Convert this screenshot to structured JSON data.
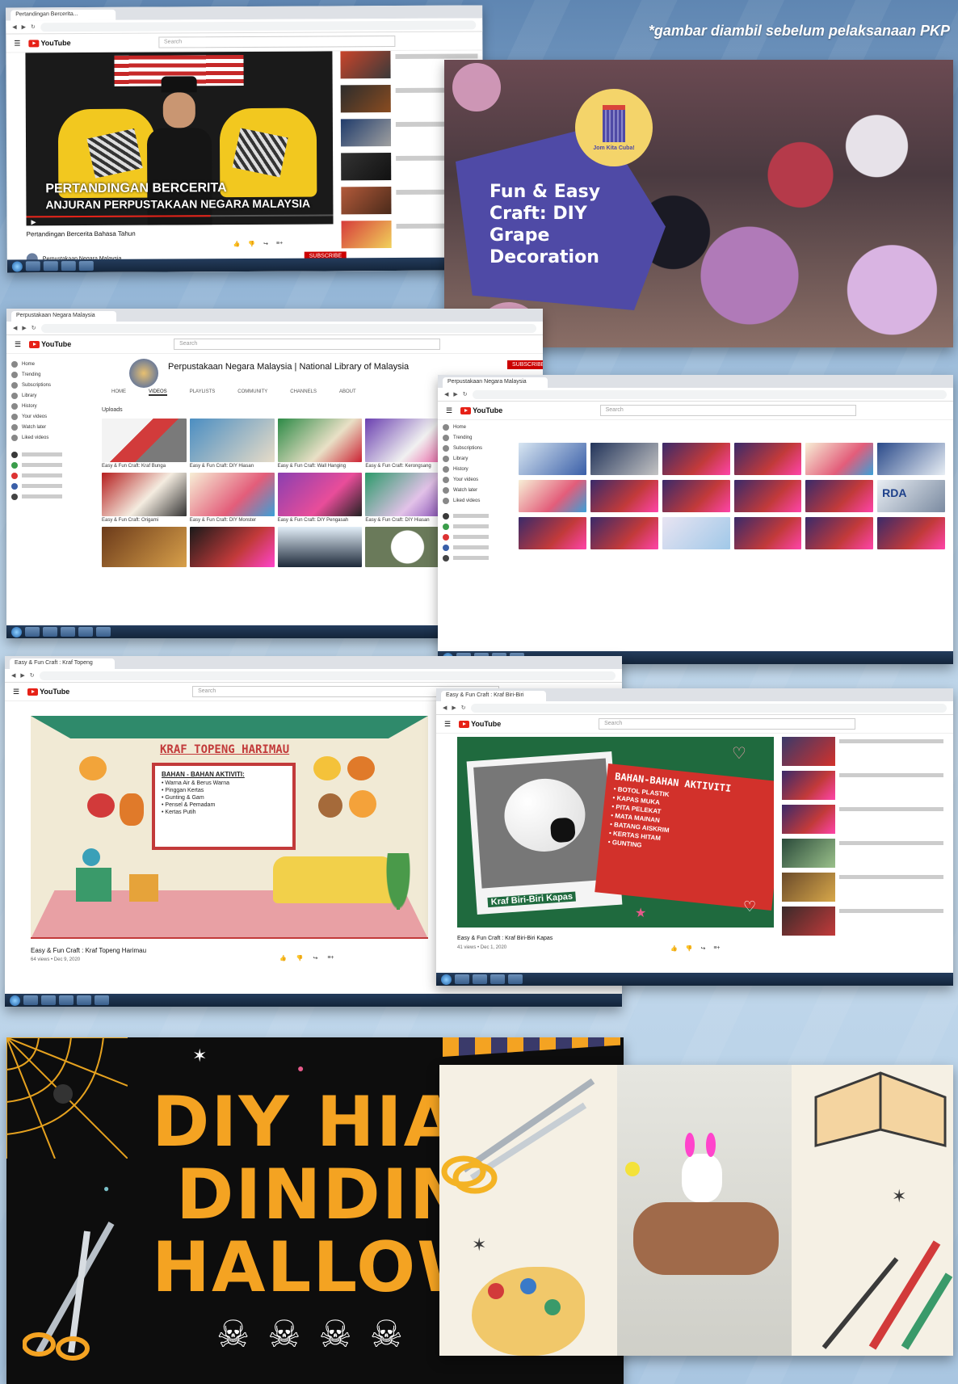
{
  "caption": "*gambar diambil sebelum pelaksanaan PKP",
  "shot1": {
    "tab": "Pertandingan Bercerita...",
    "video_overlay_line1": "PERTANDINGAN BERCERITA",
    "video_overlay_line2": "ANJURAN PERPUSTAKAAN NEGARA MALAYSIA",
    "video_title": "Pertandingan Bercerita Bahasa Tahun",
    "channel": "Perpustakaan Negara Malaysia",
    "subscribe": "SUBSCRIBE"
  },
  "shot2": {
    "title_line1": "Fun & Easy",
    "title_line2": "Craft: DIY",
    "title_line3": "Grape",
    "title_line4": "Decoration",
    "badge": "Jom Kita Cuba!"
  },
  "shot3": {
    "tab": "Perpustakaan Negara Malaysia",
    "channel_name": "Perpustakaan Negara Malaysia | National Library of Malaysia",
    "subscribe": "SUBSCRIBE",
    "tabs": [
      "HOME",
      "VIDEOS",
      "PLAYLISTS",
      "COMMUNITY",
      "CHANNELS",
      "ABOUT"
    ],
    "sidebar": [
      "Home",
      "Trending",
      "Subscriptions",
      "Library",
      "History",
      "Your videos",
      "Watch later",
      "Liked videos"
    ],
    "uploads_label": "Uploads",
    "video_titles": [
      "Easy & Fun Craft: Kraf Bunga",
      "Easy & Fun Craft: DIY Hiasan",
      "Easy & Fun Craft: Wall Hanging",
      "Easy & Fun Craft: Kerongsang",
      "Easy & Fun Craft: Origami",
      "Easy & Fun Craft: DIY Monster",
      "Easy & Fun Craft: DIY Pengasah",
      "Easy & Fun Craft: DIY Hiasan"
    ]
  },
  "shot4": {
    "tab": "Perpustakaan Negara Malaysia",
    "sidebar": [
      "Home",
      "Trending",
      "Subscriptions",
      "Library",
      "History",
      "Your videos",
      "Watch later",
      "Liked videos"
    ],
    "rda_label": "RDA"
  },
  "shot5": {
    "tab": "Easy & Fun Craft : Kraf Topeng",
    "scene_title": "KRAF TOPENG HARIMAU",
    "board_heading": "BAHAN - BAHAN AKTIVITI:",
    "board_items": [
      "Warna Air & Berus Warna",
      "Pinggan Kertas",
      "Gunting & Gam",
      "Pensel & Pemadam",
      "Kertas Putih"
    ],
    "video_title": "Easy & Fun Craft : Kraf Topeng Harimau",
    "meta": "64 views • Dec 9, 2020"
  },
  "shot6": {
    "tab": "Easy & Fun Craft : Kraf Biri-Biri",
    "heading": "BAHAN-BAHAN AKTIVITI",
    "items": [
      "BOTOL PLASTIK",
      "KAPAS MUKA",
      "PITA PELEKAT",
      "MATA MAINAN",
      "BATANG AISKRIM",
      "KERTAS HITAM",
      "GUNTING"
    ],
    "photo_label": "Kraf Biri-Biri Kapas",
    "video_title": "Easy & Fun Craft : Kraf Biri-Biri Kapas",
    "meta": "41 views • Dec 1, 2020"
  },
  "shot7": {
    "line1": "DIY HIASA",
    "line2": "DINDING",
    "line3": "HALLOWE"
  },
  "colors": {
    "yt_red": "#e62117",
    "purple_banner": "#4f4aa6",
    "halloween_orange": "#f4a322",
    "sheep_red": "#d2312b"
  }
}
